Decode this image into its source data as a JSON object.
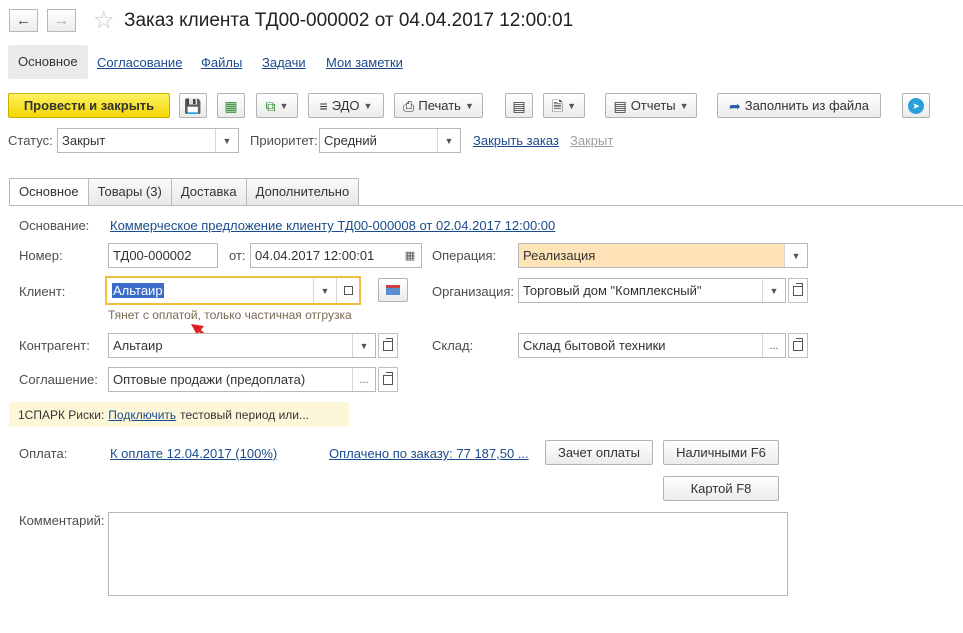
{
  "header": {
    "title": "Заказ клиента ТД00-000002 от 04.04.2017 12:00:01",
    "nav_back_icon": "arrow-left-icon",
    "nav_forward_icon": "arrow-right-icon",
    "favorite_icon": "star-icon"
  },
  "section_tabs": [
    {
      "label": "Основное",
      "active": true
    },
    {
      "label": "Согласование"
    },
    {
      "label": "Файлы"
    },
    {
      "label": "Задачи"
    },
    {
      "label": "Мои заметки"
    }
  ],
  "toolbar": {
    "post_close": "Провести и закрыть",
    "edo": "ЭДО",
    "print": "Печать",
    "reports": "Отчеты",
    "fill_from_file": "Заполнить из файла"
  },
  "status_row": {
    "status_label": "Статус:",
    "status_value": "Закрыт",
    "priority_label": "Приоритет:",
    "priority_value": "Средний",
    "close_order_link": "Закрыть заказ",
    "closed_link": "Закрыт"
  },
  "doc_tabs": [
    {
      "label": "Основное",
      "active": true
    },
    {
      "label": "Товары (3)"
    },
    {
      "label": "Доставка"
    },
    {
      "label": "Дополнительно"
    }
  ],
  "form": {
    "basis_label": "Основание:",
    "basis_value": "Коммерческое предложение клиенту ТД00-000008 от 02.04.2017 12:00:00",
    "number_label": "Номер:",
    "number_value": "ТД00-000002",
    "date_label": "от:",
    "date_value": "04.04.2017 12:00:01",
    "operation_label": "Операция:",
    "operation_value": "Реализация",
    "client_label": "Клиент:",
    "client_value": "Альтаир",
    "client_hint": "Тянет с оплатой, только частичная отгрузка",
    "organization_label": "Организация:",
    "organization_value": "Торговый дом \"Комплексный\"",
    "counterparty_label": "Контрагент:",
    "counterparty_value": "Альтаир",
    "warehouse_label": "Склад:",
    "warehouse_value": "Склад бытовой техники",
    "agreement_label": "Соглашение:",
    "agreement_value": "Оптовые продажи (предоплата)",
    "spark_prefix": "1СПАРК Риски:",
    "spark_link": "Подключить",
    "spark_suffix": "тестовый период или...",
    "payment_label": "Оплата:",
    "payment_link": "К оплате 12.04.2017 (100%)",
    "paid_link": "Оплачено по заказу: 77 187,50 ...",
    "offset_button": "Зачет оплаты",
    "cash_button": "Наличными F6",
    "card_button": "Картой F8",
    "comment_label": "Комментарий:",
    "comment_value": ""
  },
  "colors": {
    "primary_button": "#f3d600",
    "operation_highlight": "#fde3b5",
    "client_focus_border": "#f0c040",
    "selection": "#3b6cc8",
    "annotation_arrow": "#e02020"
  }
}
